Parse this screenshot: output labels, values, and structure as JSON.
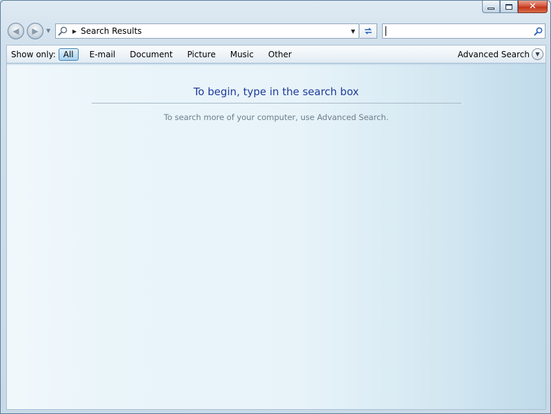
{
  "window": {
    "caption_buttons": [
      {
        "name": "minimize",
        "icon": "minimize-icon"
      },
      {
        "name": "maximize",
        "icon": "maximize-icon"
      },
      {
        "name": "close",
        "icon": "close-icon",
        "glyph": "✕"
      }
    ]
  },
  "nav": {
    "back_icon": "back-arrow-icon",
    "forward_icon": "forward-arrow-icon",
    "address": {
      "icon": "search-folder-icon",
      "path": "Search Results"
    },
    "refresh_icon": "refresh-icon",
    "search": {
      "value": "",
      "placeholder": "",
      "icon": "search-icon"
    }
  },
  "filter": {
    "label": "Show only:",
    "options": [
      "All",
      "E-mail",
      "Document",
      "Picture",
      "Music",
      "Other"
    ],
    "selected": "All",
    "advanced_label": "Advanced Search"
  },
  "content": {
    "title": "To begin, type in the search box",
    "subtitle": "To search more of your computer, use Advanced Search."
  },
  "colors": {
    "title_text": "#1e3a9a",
    "close_button": "#c2341b",
    "accent": "#2a63b8"
  }
}
